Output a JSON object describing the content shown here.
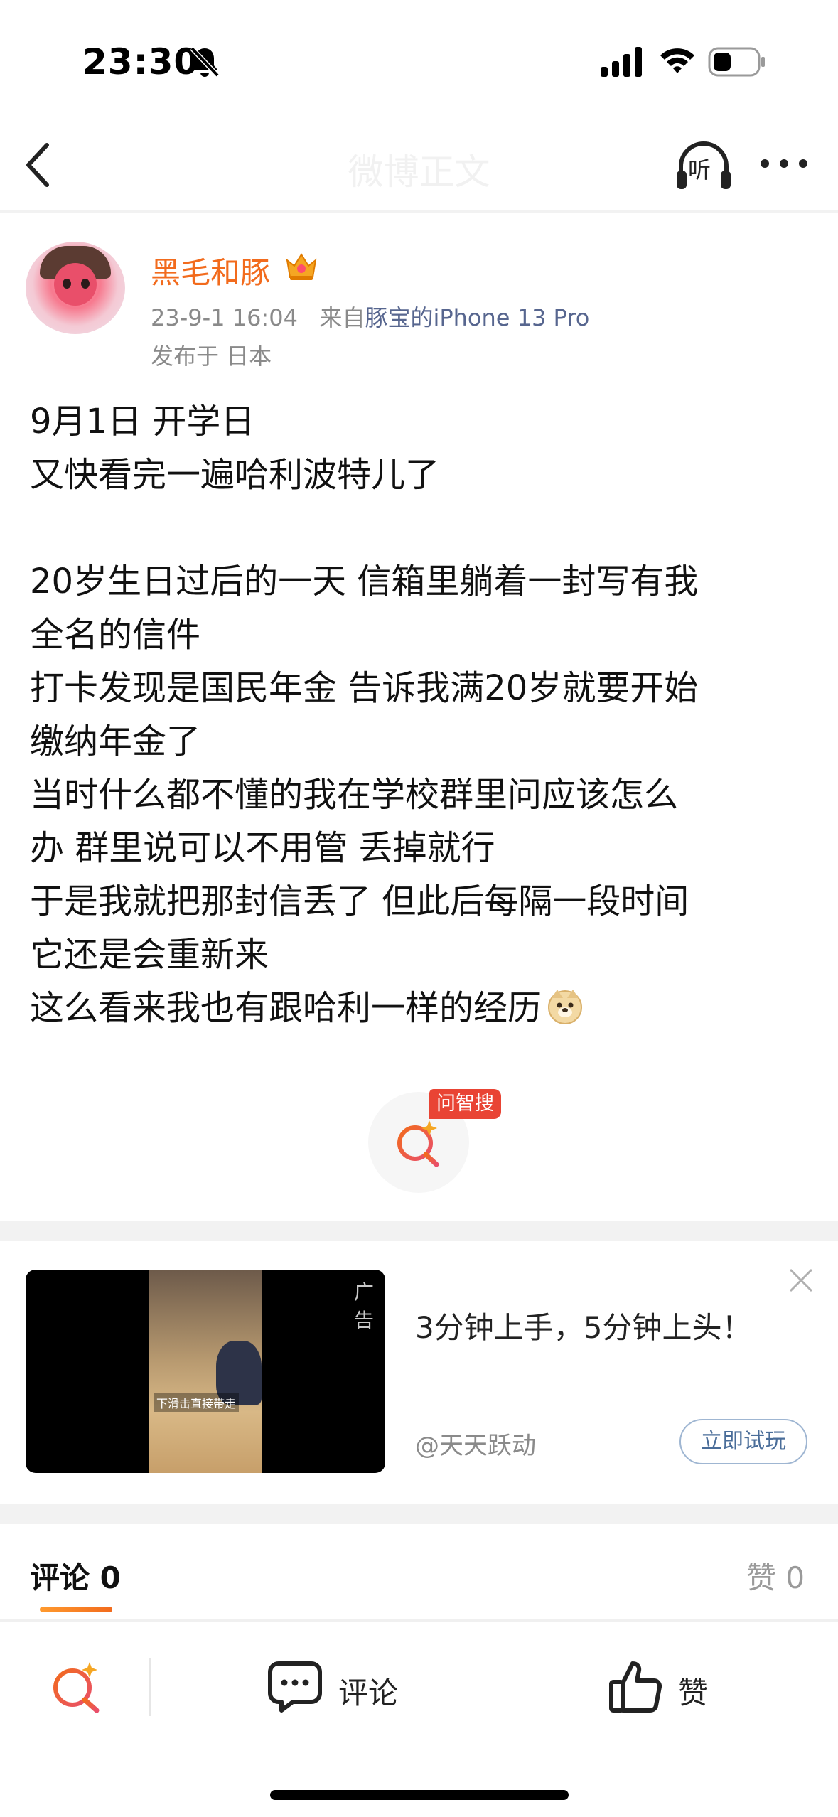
{
  "status_bar": {
    "time": "23:30"
  },
  "nav": {
    "title": "微博正文",
    "listen_label": "听"
  },
  "post": {
    "author": "黑毛和豚",
    "datetime": "23-9-1 16:04",
    "source_prefix": "来自",
    "source": "豚宝的iPhone 13 Pro",
    "location": "发布于 日本",
    "lines": [
      "9月1日 开学日",
      "又快看完一遍哈利波特儿了",
      "",
      "20岁生日过后的一天 信箱里躺着一封写有我",
      "全名的信件",
      "打卡发现是国民年金 告诉我满20岁就要开始",
      "缴纳年金了",
      "当时什么都不懂的我在学校群里问应该怎么",
      "办 群里说可以不用管 丢掉就行",
      "于是我就把那封信丢了 但此后每隔一段时间",
      "它还是会重新来",
      "这么看来我也有跟哈利一样的经历"
    ],
    "emoji": "doge-icon"
  },
  "smart_search": {
    "badge": "问智搜"
  },
  "ad": {
    "label": "广告",
    "video_caption": "下滑击直接带走",
    "title": "3分钟上手，5分钟上头！",
    "advertiser": "@天天跃动",
    "cta": "立即试玩"
  },
  "tabs": {
    "comments": "评论 0",
    "likes": "赞 0"
  },
  "toolbar": {
    "comment_label": "评论",
    "like_label": "赞"
  },
  "colors": {
    "accent": "#f26b1d",
    "source_link": "#57668f",
    "badge": "#e94434"
  }
}
